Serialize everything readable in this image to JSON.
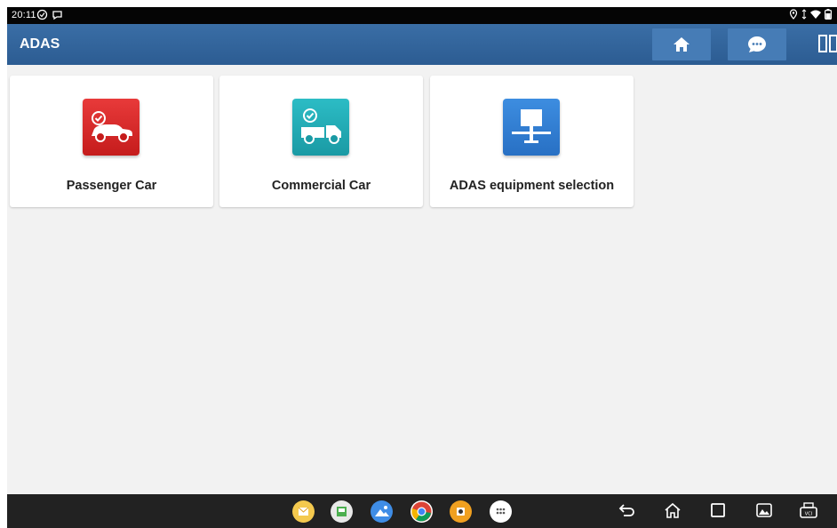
{
  "status_bar": {
    "time": "20:11"
  },
  "app_bar": {
    "title": "ADAS"
  },
  "cards": [
    {
      "label": "Passenger Car",
      "icon": "passenger-car-icon",
      "color": "#d32424"
    },
    {
      "label": "Commercial Car",
      "icon": "commercial-truck-icon",
      "color": "#22aab4"
    },
    {
      "label": "ADAS equipment selection",
      "icon": "adas-equipment-icon",
      "color": "#3380d4"
    }
  ],
  "dock": [
    {
      "icon": "email-app-icon"
    },
    {
      "icon": "gallery-app-icon"
    },
    {
      "icon": "photos-app-icon"
    },
    {
      "icon": "chrome-app-icon"
    },
    {
      "icon": "camera-app-icon"
    },
    {
      "icon": "app-drawer-icon"
    }
  ],
  "nav_buttons": [
    "back-icon",
    "home-icon",
    "recents-icon",
    "screenshot-icon",
    "vci-icon"
  ],
  "colors": {
    "app_bar": "#2f6199",
    "app_button": "#467cb6",
    "content_bg": "#f2f2f2",
    "nav_bar": "#222222"
  }
}
